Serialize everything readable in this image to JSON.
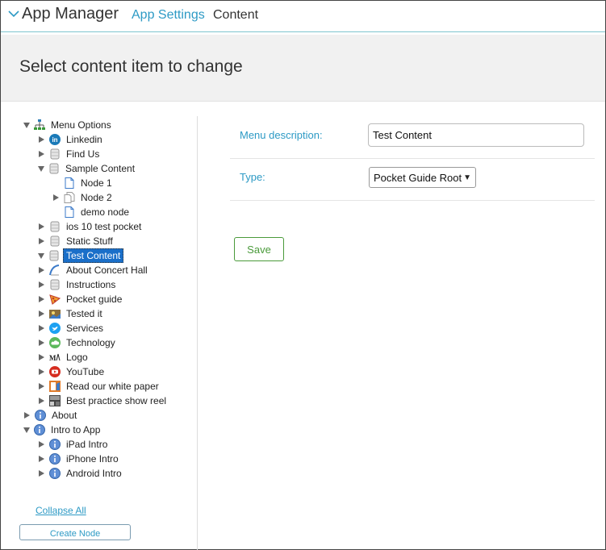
{
  "header": {
    "app_title": "App Manager",
    "breadcrumb_link": "App Settings",
    "breadcrumb_current": "Content"
  },
  "banner": {
    "title": "Select content item to change"
  },
  "tree": {
    "items": [
      {
        "label": "Menu Options",
        "icon": "sitemap-icon",
        "toggle": "expanded",
        "level": 0
      },
      {
        "label": "Linkedin",
        "icon": "linkedin-icon",
        "toggle": "collapsed",
        "level": 1
      },
      {
        "label": "Find Us",
        "icon": "database-icon",
        "toggle": "collapsed",
        "level": 1
      },
      {
        "label": "Sample Content",
        "icon": "database-icon",
        "toggle": "expanded",
        "level": 1
      },
      {
        "label": "Node 1",
        "icon": "page-icon",
        "toggle": "none",
        "level": 2
      },
      {
        "label": "Node 2",
        "icon": "pages-icon",
        "toggle": "collapsed",
        "level": 2
      },
      {
        "label": "demo node",
        "icon": "page-icon",
        "toggle": "none",
        "level": 2
      },
      {
        "label": "ios 10 test pocket",
        "icon": "database-icon",
        "toggle": "collapsed",
        "level": 1
      },
      {
        "label": "Static Stuff",
        "icon": "database-icon",
        "toggle": "collapsed",
        "level": 1
      },
      {
        "label": "Test Content",
        "icon": "database-icon",
        "toggle": "expanded",
        "level": 1,
        "selected": true
      },
      {
        "label": "About Concert Hall",
        "icon": "concert-hall-icon",
        "toggle": "collapsed",
        "level": 1
      },
      {
        "label": "Instructions",
        "icon": "database-icon",
        "toggle": "collapsed",
        "level": 1
      },
      {
        "label": "Pocket guide",
        "icon": "pizza-icon",
        "toggle": "collapsed",
        "level": 1
      },
      {
        "label": "Tested it",
        "icon": "photo-icon",
        "toggle": "collapsed",
        "level": 1
      },
      {
        "label": "Services",
        "icon": "twitter-icon",
        "toggle": "collapsed",
        "level": 1
      },
      {
        "label": "Technology",
        "icon": "cloud-icon",
        "toggle": "collapsed",
        "level": 1
      },
      {
        "label": "Logo",
        "icon": "logo-icon",
        "toggle": "collapsed",
        "level": 1
      },
      {
        "label": "YouTube",
        "icon": "youtube-icon",
        "toggle": "collapsed",
        "level": 1
      },
      {
        "label": "Read our white paper",
        "icon": "document-icon",
        "toggle": "collapsed",
        "level": 1
      },
      {
        "label": "Best practice show reel",
        "icon": "thumbnail-icon",
        "toggle": "collapsed",
        "level": 1
      },
      {
        "label": "About",
        "icon": "info-icon",
        "toggle": "collapsed",
        "level": 0
      },
      {
        "label": "Intro to App",
        "icon": "info-icon",
        "toggle": "expanded",
        "level": 0
      },
      {
        "label": "iPad Intro",
        "icon": "info-icon",
        "toggle": "collapsed",
        "level": 1
      },
      {
        "label": "iPhone Intro",
        "icon": "info-icon",
        "toggle": "collapsed",
        "level": 1
      },
      {
        "label": "Android Intro",
        "icon": "info-icon",
        "toggle": "collapsed",
        "level": 1
      }
    ],
    "collapse_all": "Collapse All",
    "create_node": "Create Node"
  },
  "form": {
    "description_label": "Menu description:",
    "description_value": "Test Content",
    "type_label": "Type:",
    "type_value": "Pocket Guide Root",
    "save_label": "Save"
  },
  "colors": {
    "accent": "#2d9ac5",
    "selection": "#1a6fc9",
    "save_green": "#4a9a3a",
    "banner_bg": "#f1f1f1"
  }
}
